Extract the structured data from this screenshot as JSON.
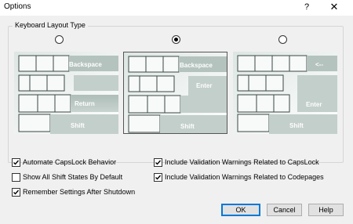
{
  "window": {
    "title": "Options",
    "help_glyph": "?",
    "close_glyph": "✕"
  },
  "group": {
    "label": "Keyboard Layout Type",
    "selected_index": 1,
    "layouts": [
      {
        "keys": [
          "Backspace",
          "Return",
          "Shift"
        ]
      },
      {
        "keys": [
          "Backspace",
          "Enter",
          "Shift"
        ]
      },
      {
        "keys": [
          "<--",
          "Enter",
          "Shift"
        ]
      }
    ]
  },
  "options": {
    "automate_capslock": {
      "label": "Automate CapsLock Behavior",
      "checked": true
    },
    "show_all_shift": {
      "label": "Show All Shift States By Default",
      "checked": false
    },
    "remember_settings": {
      "label": "Remember Settings After Shutdown",
      "checked": true
    },
    "warn_capslock": {
      "label": "Include Validation Warnings Related to CapsLock",
      "checked": true
    },
    "warn_codepages": {
      "label": "Include Validation Warnings Related to Codepages",
      "checked": true
    }
  },
  "buttons": {
    "ok": "OK",
    "cancel": "Cancel",
    "help": "Help"
  }
}
